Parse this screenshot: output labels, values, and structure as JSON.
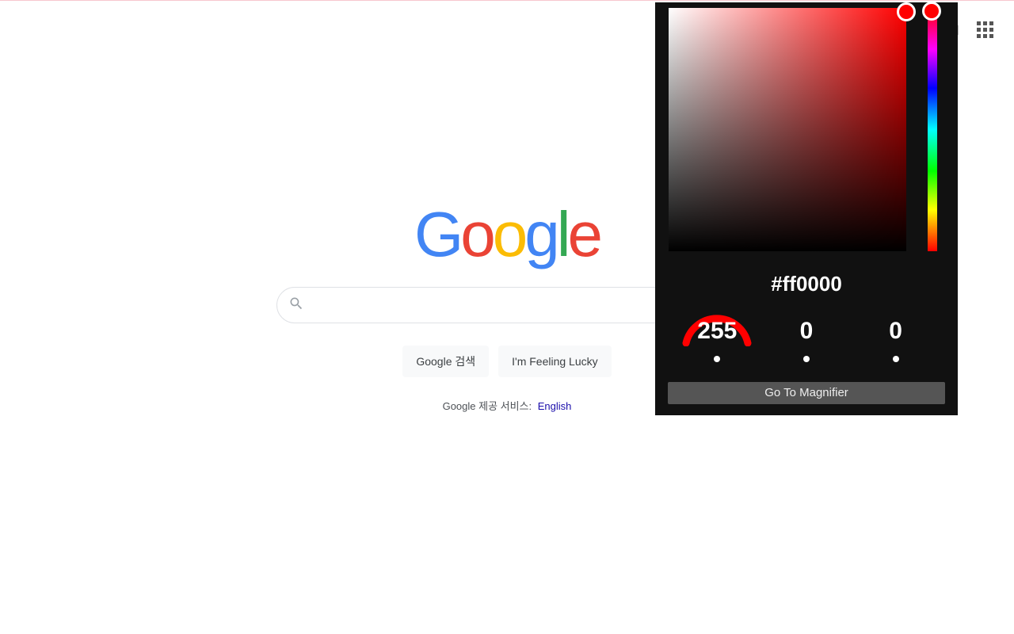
{
  "header": {
    "link_trail": "지",
    "apps_label": "apps"
  },
  "logo_letters": [
    "G",
    "o",
    "o",
    "g",
    "l",
    "e"
  ],
  "search": {
    "placeholder": ""
  },
  "buttons": {
    "search_label": "Google 검색",
    "lucky_label": "I'm Feeling Lucky"
  },
  "lang": {
    "prefix": "Google 제공 서비스:",
    "link": "English"
  },
  "picker": {
    "hex": "#ff0000",
    "r": "255",
    "g": "0",
    "b": "0",
    "magnifier_label": "Go To Magnifier",
    "hue_color": "#ff0000",
    "selected_color": "#ff0000"
  }
}
